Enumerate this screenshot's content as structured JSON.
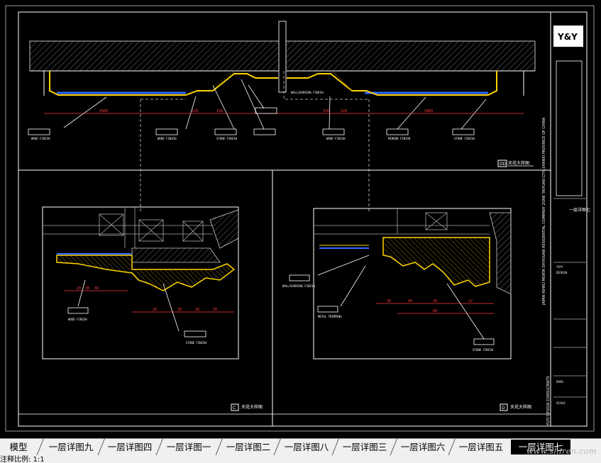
{
  "drawing": {
    "logo_text": "Y&Y",
    "sheet_code": "一层详图七",
    "project_vertical_text": "JAPAN RIHKO MORTA SHIYOUAN RESIDENTIAL COMPANY ZONE  TAIYUAN CITY,SHANXI PROVINCE OF CHINA",
    "designer_vertical_text": "YUYI DESIGN CONSULTANTS",
    "section_labels": {
      "top": "DD",
      "bottom_left": "C",
      "bottom_right": "D"
    },
    "titles": {
      "top_title": "天花大样图",
      "bottom_left_title": "天花大样图",
      "bottom_right_title": "天花大样图"
    },
    "callouts": {
      "wood_finish": "WOOD FINISH",
      "stone_finish": "STONE FINISH",
      "wallcovering_finish": "WALLCOVERING FINISH",
      "metal_trimming": "METAL TRIMMING",
      "mirror_finish": "MIRROR FINISH"
    },
    "dimensions_top": [
      "120",
      "80",
      "150",
      "120",
      "150",
      "120",
      "80"
    ],
    "dimensions_bottom_left": [
      "20",
      "30",
      "48",
      "20",
      "30",
      "28",
      "50"
    ],
    "dimensions_bottom_right": [
      "30",
      "40",
      "80",
      "20",
      "12"
    ]
  },
  "tabs": [
    {
      "label": "模型",
      "active": false
    },
    {
      "label": "一层详图九",
      "active": false
    },
    {
      "label": "一层详图四",
      "active": false
    },
    {
      "label": "一层详图一",
      "active": false
    },
    {
      "label": "一层详图二",
      "active": false
    },
    {
      "label": "一层详图八",
      "active": false
    },
    {
      "label": "一层详图三",
      "active": false
    },
    {
      "label": "一层详图六",
      "active": false
    },
    {
      "label": "一层详图五",
      "active": false
    },
    {
      "label": "一层详图七",
      "active": true
    }
  ],
  "watermark": "www.shiren.com",
  "status": {
    "text": "注释比例: 1:1"
  },
  "colors": {
    "background": "#000000",
    "line_white": "#ffffff",
    "hatch_gray": "#7a7a7a",
    "accent_yellow": "#ffd400",
    "accent_blue": "#2f6bff",
    "dim_red": "#ff3b3b"
  }
}
